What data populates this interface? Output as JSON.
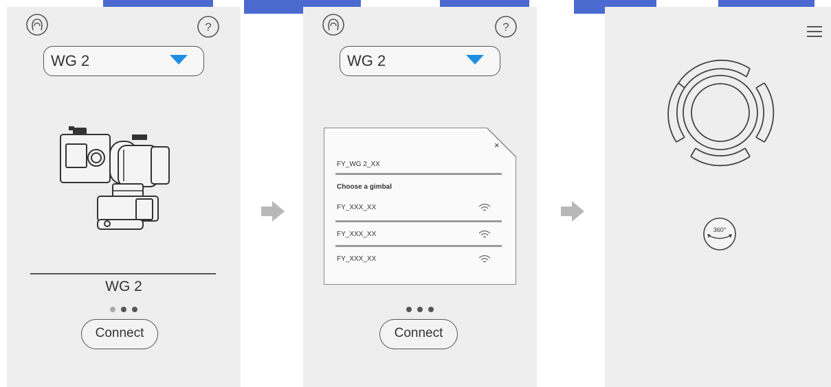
{
  "theme": {
    "watermark": "#4a6ad0",
    "panel": "#eeeeee",
    "accent": "#1e8fe0",
    "dot": "#555555",
    "arrow": "#b8b8b8"
  },
  "screens": [
    {
      "icons": [
        "profile-icon",
        "help-icon"
      ],
      "select_value": "WG 2",
      "device_name": "WG 2",
      "page_dots": 3,
      "connect_label": "Connect"
    },
    {
      "icons": [
        "profile-icon",
        "help-icon"
      ],
      "select_value": "WG 2",
      "dialog": {
        "close": "×",
        "current": "FY_WG 2_XX",
        "heading": "Choose a gimbal",
        "items": [
          "FY_XXX_XX",
          "FY_XXX_XX",
          "FY_XXX_XX"
        ]
      },
      "page_dots": 3,
      "connect_label": "Connect"
    },
    {
      "icons": [
        "menu-icon",
        "joystick-control",
        "rotate-360-icon"
      ],
      "rotate_label": "360°"
    }
  ],
  "flow_arrows": [
    "arrow-right-icon",
    "arrow-right-icon"
  ]
}
